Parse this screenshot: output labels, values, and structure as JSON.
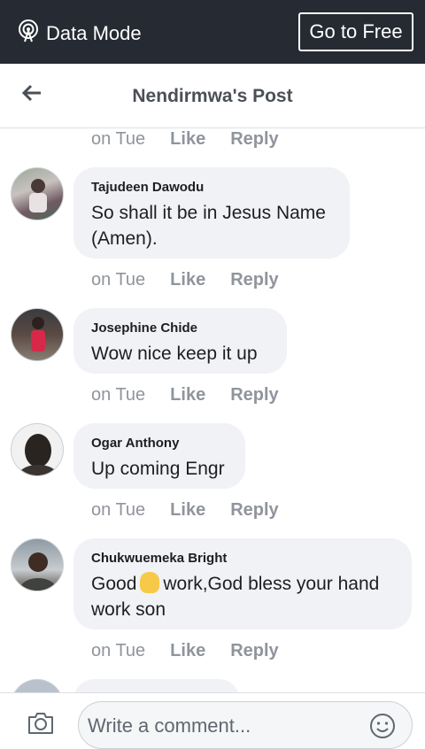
{
  "topbar": {
    "data_mode_label": "Data Mode",
    "go_free_label": "Go to Free"
  },
  "header": {
    "title": "Nendirmwa's Post"
  },
  "actions": {
    "time": "on Tue",
    "like": "Like",
    "reply": "Reply"
  },
  "comments": [
    {
      "name": "Tajudeen Dawodu",
      "text_line1": "So shall it be in Jesus Name",
      "text_line2": "(Amen)."
    },
    {
      "name": "Josephine Chide",
      "text": "Wow nice keep it up"
    },
    {
      "name": "Ogar Anthony",
      "text": "Up coming Engr"
    },
    {
      "name": "Chukwuemeka Bright",
      "text_pre": "Good",
      "text_post": "work,God bless your hand",
      "text_line2": "work son"
    }
  ],
  "composer": {
    "placeholder": "Write a comment..."
  },
  "colors": {
    "topbar": "#252a33",
    "bubble": "#f0f2f5",
    "muted": "#90949c"
  }
}
